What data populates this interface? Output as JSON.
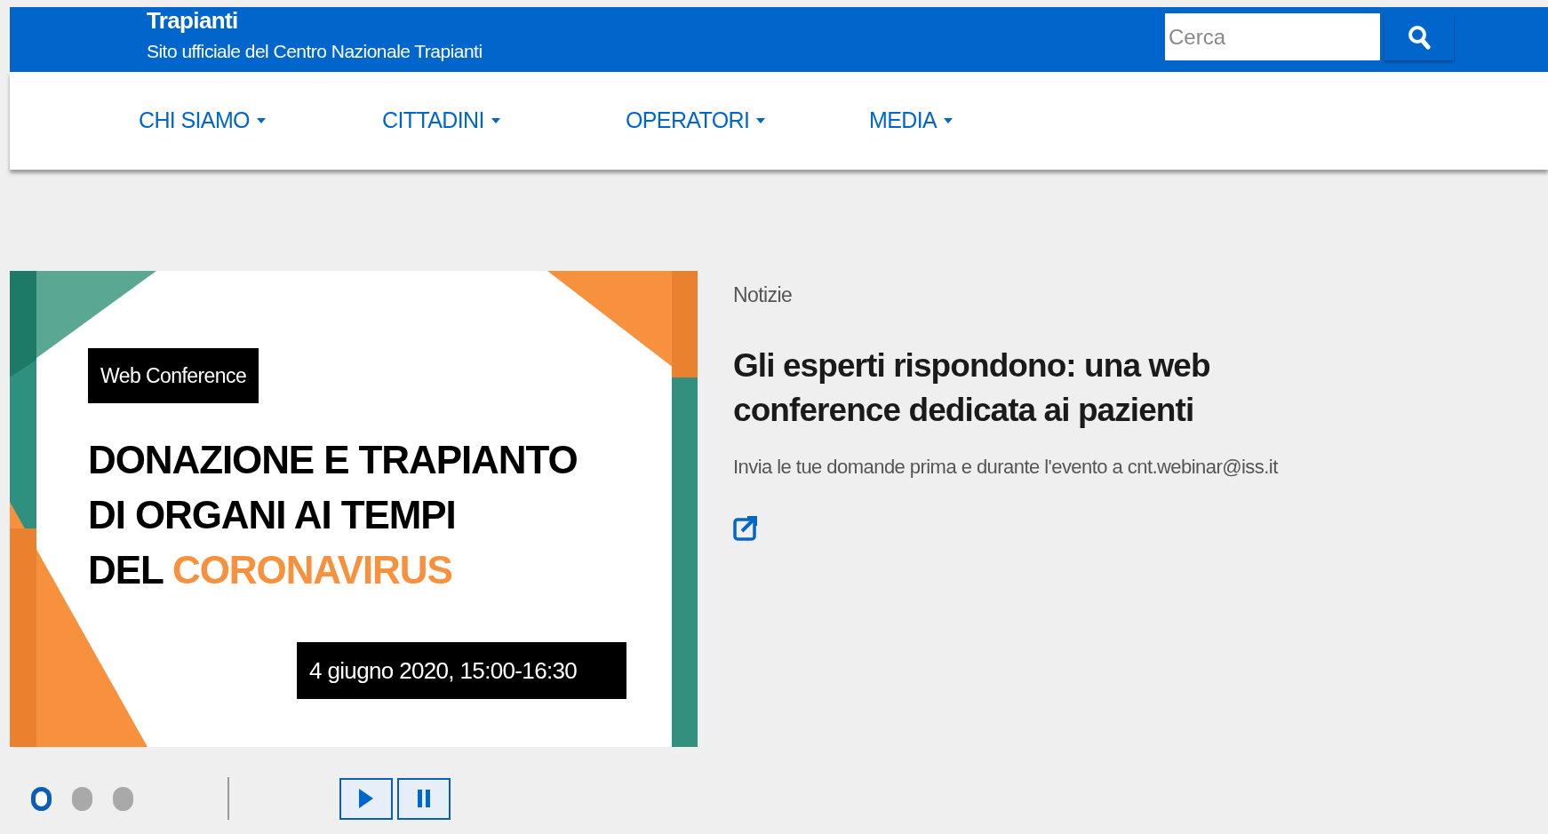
{
  "header": {
    "title": "Trapianti",
    "subtitle": "Sito ufficiale del Centro Nazionale Trapianti",
    "search": {
      "placeholder": "Cerca"
    }
  },
  "nav": [
    {
      "label": "CHI SIAMO"
    },
    {
      "label": "CITTADINI"
    },
    {
      "label": "OPERATORI"
    },
    {
      "label": "MEDIA"
    }
  ],
  "slide": {
    "badge": "Web Conference",
    "headline_lines": [
      "DONAZIONE E TRAPIANTO",
      "DI ORGANI AI TEMPI"
    ],
    "headline_last": "DEL",
    "headline_highlight": "CORONAVIRUS",
    "date": "4 giugno 2020, 15:00-16:30"
  },
  "news": {
    "category": "Notizie",
    "title": "Gli esperti rispondono: una web conference dedicata ai pazienti",
    "description": "Invia le tue domande prima e durante l'evento a cnt.webinar@iss.it"
  },
  "carousel": {
    "dots": [
      {
        "selected": true
      },
      {
        "selected": false
      },
      {
        "selected": false
      }
    ]
  }
}
